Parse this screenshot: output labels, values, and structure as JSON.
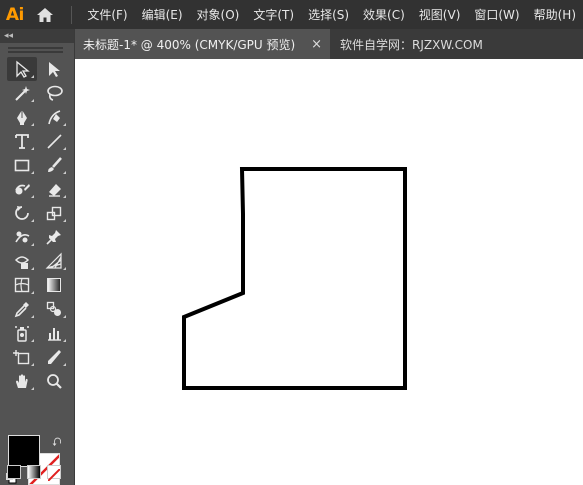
{
  "app": {
    "logo": "Ai"
  },
  "menu": [
    "文件(F)",
    "编辑(E)",
    "对象(O)",
    "文字(T)",
    "选择(S)",
    "效果(C)",
    "视图(V)",
    "窗口(W)",
    "帮助(H)"
  ],
  "toolbar": {
    "collapse_label": "◂◂",
    "tools": [
      {
        "name": "selection-tool",
        "icon": "selection-arrow"
      },
      {
        "name": "direct-selection-tool",
        "icon": "direct-selection-arrow"
      },
      {
        "name": "magic-wand-tool",
        "icon": "magic-wand"
      },
      {
        "name": "lasso-tool",
        "icon": "lasso"
      },
      {
        "name": "pen-tool",
        "icon": "pen"
      },
      {
        "name": "curvature-tool",
        "icon": "curvature-pen"
      },
      {
        "name": "type-tool",
        "icon": "type-T"
      },
      {
        "name": "line-segment-tool",
        "icon": "line"
      },
      {
        "name": "rectangle-tool",
        "icon": "rectangle"
      },
      {
        "name": "paintbrush-tool",
        "icon": "brush"
      },
      {
        "name": "shaper-tool",
        "icon": "shaper"
      },
      {
        "name": "eraser-tool",
        "icon": "eraser"
      },
      {
        "name": "rotate-tool",
        "icon": "rotate"
      },
      {
        "name": "scale-tool",
        "icon": "scale"
      },
      {
        "name": "puppet-warp-tool",
        "icon": "puppet"
      },
      {
        "name": "pin-tool",
        "icon": "pin"
      },
      {
        "name": "free-transform-tool",
        "icon": "free-transform"
      },
      {
        "name": "perspective-grid-tool",
        "icon": "perspective"
      },
      {
        "name": "mesh-tool",
        "icon": "mesh"
      },
      {
        "name": "gradient-tool",
        "icon": "gradient"
      },
      {
        "name": "eyedropper-tool",
        "icon": "eyedropper"
      },
      {
        "name": "blend-tool",
        "icon": "blend"
      },
      {
        "name": "symbol-sprayer-tool",
        "icon": "symbol-sprayer"
      },
      {
        "name": "column-graph-tool",
        "icon": "bar-graph"
      },
      {
        "name": "artboard-tool",
        "icon": "artboard"
      },
      {
        "name": "slice-tool",
        "icon": "knife"
      },
      {
        "name": "hand-tool",
        "icon": "hand"
      },
      {
        "name": "zoom-tool",
        "icon": "magnifier"
      }
    ],
    "fill_color": "#000000",
    "stroke": "none"
  },
  "tabs": [
    {
      "label": "未标题-1* @ 400% (CMYK/GPU 预览)",
      "close": "×",
      "active": true
    },
    {
      "label": "软件自学网：RJZXW.COM",
      "active": false
    }
  ],
  "canvas": {
    "background": "#ffffff",
    "shape_stroke": "#000000"
  }
}
